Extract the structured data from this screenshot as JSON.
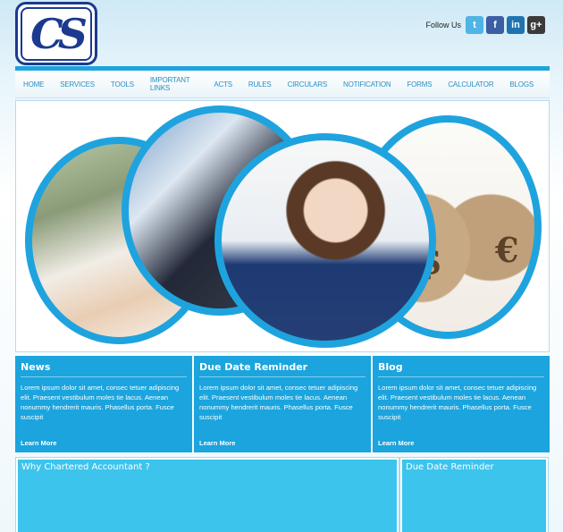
{
  "logo": {
    "text": "CS"
  },
  "follow": {
    "label": "Follow Us",
    "icons": [
      {
        "name": "twitter-icon",
        "glyph": "t",
        "color": "#4fb4e6"
      },
      {
        "name": "facebook-icon",
        "glyph": "f",
        "color": "#3b5ea5"
      },
      {
        "name": "linkedin-icon",
        "glyph": "in",
        "color": "#1f73b0"
      },
      {
        "name": "google-plus-icon",
        "glyph": "g+",
        "color": "#3a3a3a"
      }
    ]
  },
  "nav": {
    "items": [
      "HOME",
      "SERVICES",
      "TOOLS",
      "IMPORTANT LINKS",
      "ACTS",
      "RULES",
      "CIRCULARS",
      "NOTIFICATION",
      "FORMS",
      "CALCULATOR",
      "BLOGS"
    ]
  },
  "banner": {
    "symbols": [
      "$",
      "€"
    ]
  },
  "boxes": [
    {
      "title": "News",
      "text": "Lorem ipsum dolor sit amet, consec tetuer adipiscing elit. Praesent vestibulum moles tie lacus. Aenean nonummy hendrerit mauris. Phasellus porta. Fusce suscipit",
      "link": "Learn More"
    },
    {
      "title": "Due Date Reminder",
      "text": "Lorem ipsum dolor sit amet, consec tetuer adipiscing elit. Praesent vestibulum moles tie lacus. Aenean nonummy hendrerit mauris. Phasellus porta. Fusce suscipit",
      "link": "Learn More"
    },
    {
      "title": "Blog",
      "text": "Lorem ipsum dolor sit amet, consec tetuer adipiscing elit. Praesent vestibulum moles tie lacus. Aenean nonummy hendrerit mauris. Phasellus porta. Fusce suscipit",
      "link": "Learn More"
    }
  ],
  "bottom": {
    "left_title": "Why Chartered Accountant ?",
    "right_title": "Due Date Reminder"
  },
  "colors": {
    "accent": "#1ba4dd",
    "logo": "#1b3a8f"
  }
}
